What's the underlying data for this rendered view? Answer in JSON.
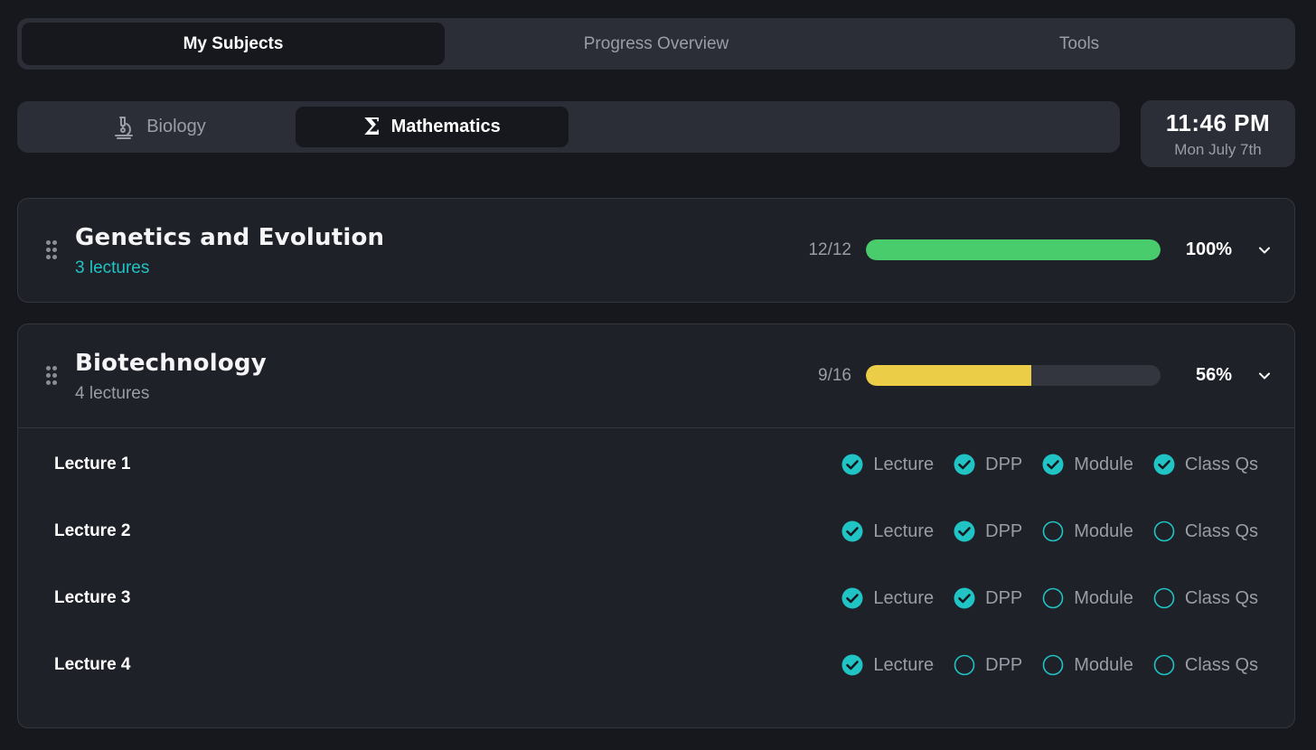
{
  "top_tabs": [
    {
      "label": "My Subjects",
      "active": true
    },
    {
      "label": "Progress Overview",
      "active": false
    },
    {
      "label": "Tools",
      "active": false
    }
  ],
  "subject_tabs": [
    {
      "label": "Biology",
      "icon": "microscope-icon",
      "active": false
    },
    {
      "label": "Mathematics",
      "icon": "sigma-icon",
      "active": true
    }
  ],
  "clock": {
    "time": "11:46 PM",
    "date": "Mon July 7th"
  },
  "colors": {
    "accent": "#20c4c4",
    "complete": "#48cc6c",
    "partial": "#ebcd48"
  },
  "chapters": [
    {
      "title": "Genetics and Evolution",
      "lectures_label": "3 lectures",
      "done": "12/12",
      "percent_label": "100%",
      "progress": 1.0,
      "expanded": false
    },
    {
      "title": "Biotechnology",
      "lectures_label": "4 lectures",
      "done": "9/16",
      "percent_label": "56%",
      "progress": 0.5625,
      "expanded": true,
      "lectures": [
        {
          "name": "Lecture 1",
          "items": [
            {
              "label": "Lecture",
              "checked": true
            },
            {
              "label": "DPP",
              "checked": true
            },
            {
              "label": "Module",
              "checked": true
            },
            {
              "label": "Class Qs",
              "checked": true
            }
          ]
        },
        {
          "name": "Lecture 2",
          "items": [
            {
              "label": "Lecture",
              "checked": true
            },
            {
              "label": "DPP",
              "checked": true
            },
            {
              "label": "Module",
              "checked": false
            },
            {
              "label": "Class Qs",
              "checked": false
            }
          ]
        },
        {
          "name": "Lecture 3",
          "items": [
            {
              "label": "Lecture",
              "checked": true
            },
            {
              "label": "DPP",
              "checked": true
            },
            {
              "label": "Module",
              "checked": false
            },
            {
              "label": "Class Qs",
              "checked": false
            }
          ]
        },
        {
          "name": "Lecture 4",
          "items": [
            {
              "label": "Lecture",
              "checked": true
            },
            {
              "label": "DPP",
              "checked": false
            },
            {
              "label": "Module",
              "checked": false
            },
            {
              "label": "Class Qs",
              "checked": false
            }
          ]
        }
      ]
    }
  ]
}
